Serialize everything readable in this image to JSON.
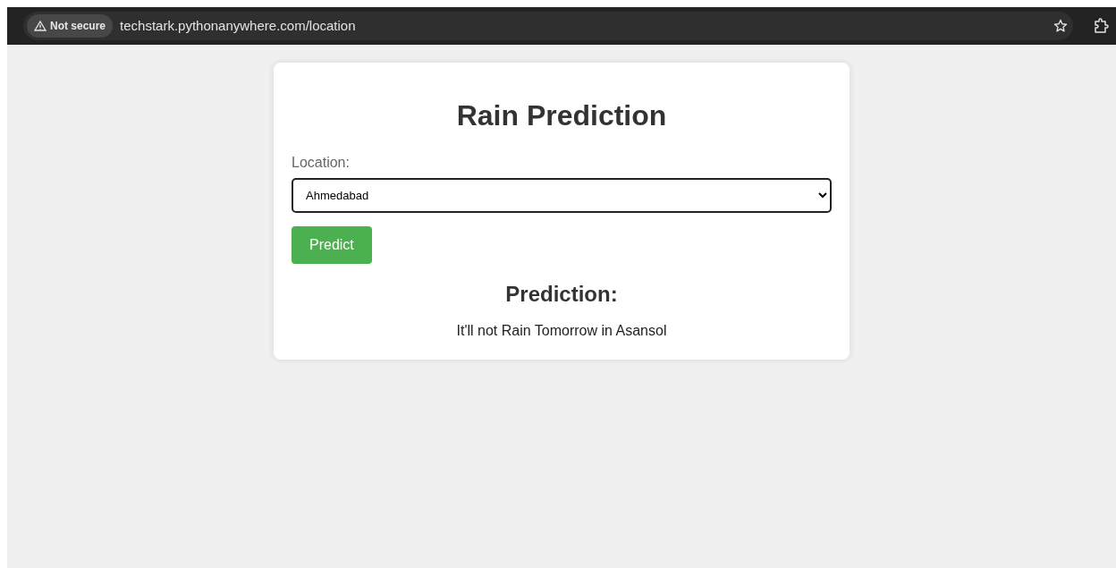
{
  "browser": {
    "security_label": "Not secure",
    "url": "techstark.pythonanywhere.com/location"
  },
  "card": {
    "title": "Rain Prediction",
    "field_label": "Location:",
    "location_value": "Ahmedabad",
    "button": "Predict",
    "result_heading": "Prediction:",
    "result_text": "It'll not Rain Tomorrow in Asansol"
  }
}
